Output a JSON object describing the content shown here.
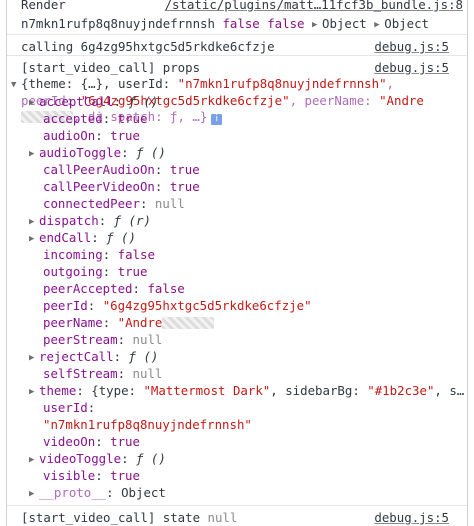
{
  "render_entry": {
    "line1_label": "Render",
    "line1_source": "/static/plugins/matt…11fcf3b_bundle.js:8",
    "line2_user": "n7mkn1rufp8q8nuyjndefrnnsh",
    "line2_false1": "false",
    "line2_false2": "false",
    "line2_obj1": "Object",
    "line2_obj2": "Object"
  },
  "calling_entry": {
    "text": "calling 6g4zg95hxtgc5d5rkdke6cfzje",
    "source": "debug.js:5"
  },
  "props_entry": {
    "header": "[start_video_call] props",
    "source": "debug.js:5",
    "summary": {
      "open": "{theme: {…}, userId: ",
      "userId": "\"n7mkn1rufp8q8nuyjndefrnnsh\"",
      "sep1": ", peerId:",
      "peerId": "\"6g4zg95hxtgc5d5rkdke6cfzje\"",
      "sep2": ", peerName: ",
      "peerName": "\"Andre",
      "sep3": ", di",
      "tail": "spatch: ƒ, …}"
    },
    "properties": [
      {
        "name": "acceptCall",
        "value": "ƒ ()",
        "type": "fn",
        "expandable": true
      },
      {
        "name": "accepted",
        "value": "true",
        "type": "bool",
        "expandable": false
      },
      {
        "name": "audioOn",
        "value": "true",
        "type": "bool",
        "expandable": false
      },
      {
        "name": "audioToggle",
        "value": "ƒ ()",
        "type": "fn",
        "expandable": true
      },
      {
        "name": "callPeerAudioOn",
        "value": "true",
        "type": "bool",
        "expandable": false
      },
      {
        "name": "callPeerVideoOn",
        "value": "true",
        "type": "bool",
        "expandable": false
      },
      {
        "name": "connectedPeer",
        "value": "null",
        "type": "null",
        "expandable": false
      },
      {
        "name": "dispatch",
        "value": "ƒ (r)",
        "type": "fn",
        "expandable": true
      },
      {
        "name": "endCall",
        "value": "ƒ ()",
        "type": "fn",
        "expandable": true
      },
      {
        "name": "incoming",
        "value": "false",
        "type": "bool",
        "expandable": false
      },
      {
        "name": "outgoing",
        "value": "true",
        "type": "bool",
        "expandable": false
      },
      {
        "name": "peerAccepted",
        "value": "false",
        "type": "bool",
        "expandable": false
      },
      {
        "name": "peerId",
        "value": "\"6g4zg95hxtgc5d5rkdke6cfzje\"",
        "type": "str",
        "expandable": false
      },
      {
        "name": "peerName",
        "value": "\"Andre",
        "type": "str-blur",
        "expandable": false
      },
      {
        "name": "peerStream",
        "value": "null",
        "type": "null",
        "expandable": false
      },
      {
        "name": "rejectCall",
        "value": "ƒ ()",
        "type": "fn",
        "expandable": true
      },
      {
        "name": "selfStream",
        "value": "null",
        "type": "null",
        "expandable": false
      }
    ],
    "theme": {
      "name": "theme",
      "open": "{type: ",
      "type_val": "\"Mattermost Dark\"",
      "sep": ", sidebarBg: ",
      "sidebar_val": "\"#1b2c3e\"",
      "tail": ", s…"
    },
    "userId": {
      "name": "userId",
      "value": "\"n7mkn1rufp8q8nuyjndefrnnsh\""
    },
    "properties2": [
      {
        "name": "videoOn",
        "value": "true",
        "type": "bool",
        "expandable": false
      },
      {
        "name": "videoToggle",
        "value": "ƒ ()",
        "type": "fn",
        "expandable": true
      },
      {
        "name": "visible",
        "value": "true",
        "type": "bool",
        "expandable": false
      }
    ],
    "proto": {
      "name": "__proto__",
      "value": "Object"
    }
  },
  "state_entry": {
    "header": "[start_video_call] state",
    "value": "null",
    "source": "debug.js:5"
  },
  "colors": {
    "keyword": "#881280",
    "string": "#c41a16",
    "property": "#881391",
    "dim": "#8c8c8c"
  }
}
